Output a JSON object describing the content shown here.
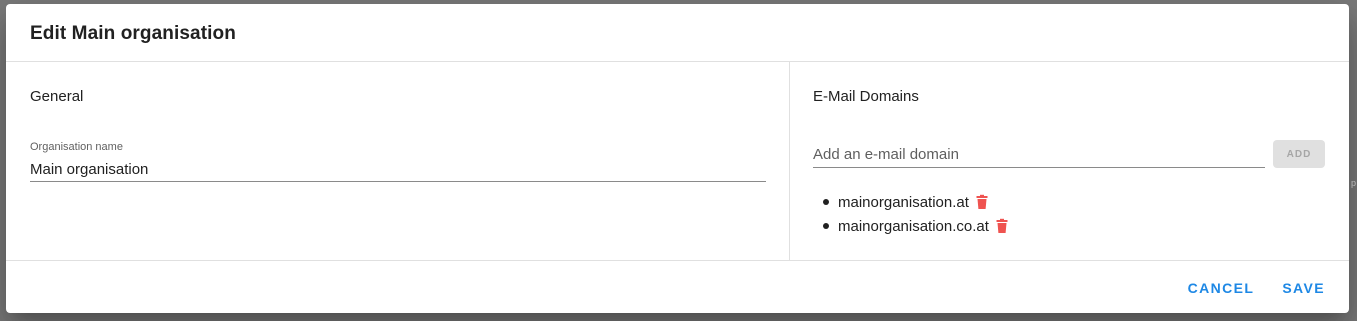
{
  "dialog": {
    "title": "Edit Main organisation"
  },
  "general": {
    "heading": "General",
    "org_name_label": "Organisation name",
    "org_name_value": "Main organisation"
  },
  "email_domains": {
    "heading": "E-Mail Domains",
    "input_placeholder": "Add an e-mail domain",
    "input_value": "",
    "add_label": "ADD",
    "items": [
      {
        "domain": "mainorganisation.at",
        "icon": "trash-icon"
      },
      {
        "domain": "mainorganisation.co.at",
        "icon": "trash-icon"
      }
    ]
  },
  "actions": {
    "cancel_label": "CANCEL",
    "save_label": "SAVE"
  },
  "colors": {
    "accent": "#1e88e5",
    "delete": "#ef5350"
  }
}
